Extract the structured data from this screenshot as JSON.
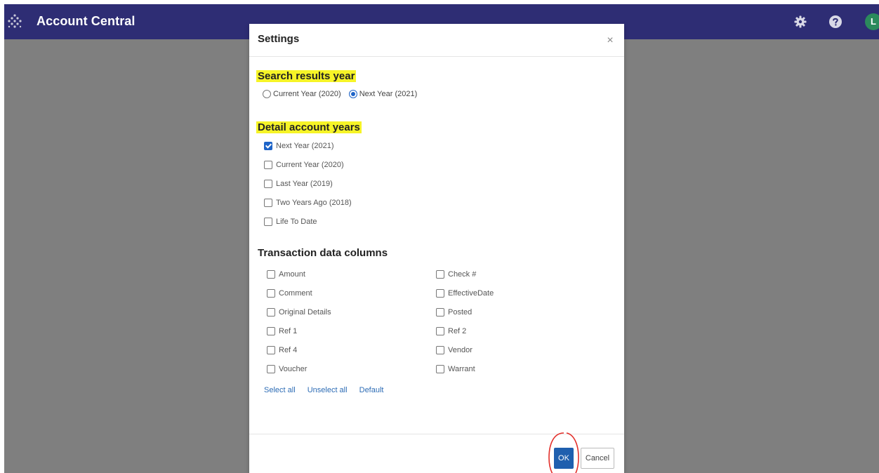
{
  "app": {
    "title": "Account Central",
    "avatar_letter": "L"
  },
  "topbar_icons": [
    "gear-icon",
    "help-icon"
  ],
  "colors": {
    "topbar": "#2e2d74",
    "overlay": "#7f7f7f",
    "accent": "#1e64c8",
    "highlight": "#f6f427",
    "ok_button": "#1f5fae",
    "annotation": "#e3302b"
  },
  "dialog": {
    "title": "Settings",
    "close_label": "×",
    "search_year": {
      "title": "Search results year",
      "options": [
        {
          "label": "Current Year (2020)",
          "selected": false
        },
        {
          "label": "Next Year (2021)",
          "selected": true
        }
      ]
    },
    "detail_years": {
      "title": "Detail account years",
      "items": [
        {
          "label": "Next Year (2021)",
          "checked": true
        },
        {
          "label": "Current Year (2020)",
          "checked": false
        },
        {
          "label": "Last Year (2019)",
          "checked": false
        },
        {
          "label": "Two Years Ago (2018)",
          "checked": false
        },
        {
          "label": "Life To Date",
          "checked": false
        }
      ]
    },
    "transaction_columns": {
      "title": "Transaction data columns",
      "left": [
        {
          "label": "Amount",
          "checked": false
        },
        {
          "label": "Comment",
          "checked": false
        },
        {
          "label": "Original Details",
          "checked": false
        },
        {
          "label": "Ref 1",
          "checked": false
        },
        {
          "label": "Ref 4",
          "checked": false
        },
        {
          "label": "Voucher",
          "checked": false
        }
      ],
      "right": [
        {
          "label": "Check #",
          "checked": false
        },
        {
          "label": "EffectiveDate",
          "checked": false
        },
        {
          "label": "Posted",
          "checked": false
        },
        {
          "label": "Ref 2",
          "checked": false
        },
        {
          "label": "Vendor",
          "checked": false
        },
        {
          "label": "Warrant",
          "checked": false
        }
      ]
    },
    "links": {
      "select_all": "Select all",
      "unselect_all": "Unselect all",
      "default": "Default"
    },
    "buttons": {
      "ok": "OK",
      "cancel": "Cancel"
    }
  }
}
